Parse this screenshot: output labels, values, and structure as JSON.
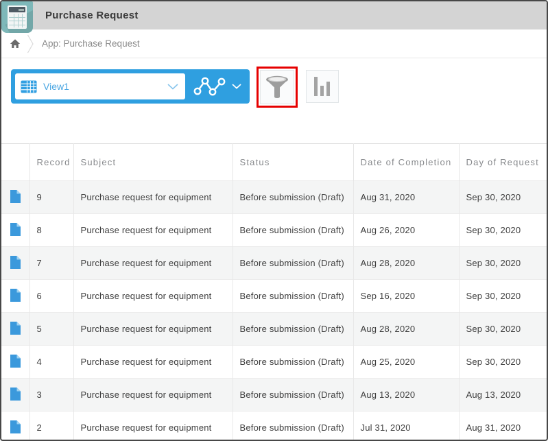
{
  "header": {
    "title": "Purchase Request",
    "bar_color": "#d4d4d4",
    "app_icon": "calculator-app-icon",
    "app_icon_color": "#7eb8b9"
  },
  "breadcrumb": {
    "home_icon": "home-icon",
    "separator_icon": "chevron-right-icon",
    "text": "App: Purchase Request"
  },
  "toolbar": {
    "accent_blue": "#2f9fe0",
    "view_selector": {
      "icon": "table-view-icon",
      "value": "View1",
      "chevron_icon": "chevron-down-icon"
    },
    "graph_button": {
      "icon": "line-graph-icon",
      "chevron_icon": "chevron-down-icon"
    },
    "filter_button": {
      "icon": "filter-funnel-icon",
      "highlighted": true,
      "highlight_color": "#e60000"
    },
    "chart_button": {
      "icon": "bar-chart-icon"
    }
  },
  "table": {
    "columns": [
      "",
      "Record",
      "Subject",
      "Status",
      "Date of Completion",
      "Day of Request"
    ],
    "row_icon": "document-icon",
    "rows": [
      {
        "record": "9",
        "subject": "Purchase request for equipment",
        "status": "Before submission (Draft)",
        "completion": "Aug 31, 2020",
        "request": "Sep 30, 2020"
      },
      {
        "record": "8",
        "subject": "Purchase request for equipment",
        "status": "Before submission (Draft)",
        "completion": "Aug 26, 2020",
        "request": "Sep 30, 2020"
      },
      {
        "record": "7",
        "subject": "Purchase request for equipment",
        "status": "Before submission (Draft)",
        "completion": "Aug 28, 2020",
        "request": "Sep 30, 2020"
      },
      {
        "record": "6",
        "subject": "Purchase request for equipment",
        "status": "Before submission (Draft)",
        "completion": "Sep 16, 2020",
        "request": "Sep 30, 2020"
      },
      {
        "record": "5",
        "subject": "Purchase request for equipment",
        "status": "Before submission (Draft)",
        "completion": "Aug 28, 2020",
        "request": "Sep 30, 2020"
      },
      {
        "record": "4",
        "subject": "Purchase request for equipment",
        "status": "Before submission (Draft)",
        "completion": "Aug 25, 2020",
        "request": "Sep 30, 2020"
      },
      {
        "record": "3",
        "subject": "Purchase request for equipment",
        "status": "Before submission (Draft)",
        "completion": "Aug 13, 2020",
        "request": "Aug 13, 2020"
      },
      {
        "record": "2",
        "subject": "Purchase request for equipment",
        "status": "Before submission (Draft)",
        "completion": "Jul 31, 2020",
        "request": "Aug 31, 2020"
      }
    ]
  }
}
